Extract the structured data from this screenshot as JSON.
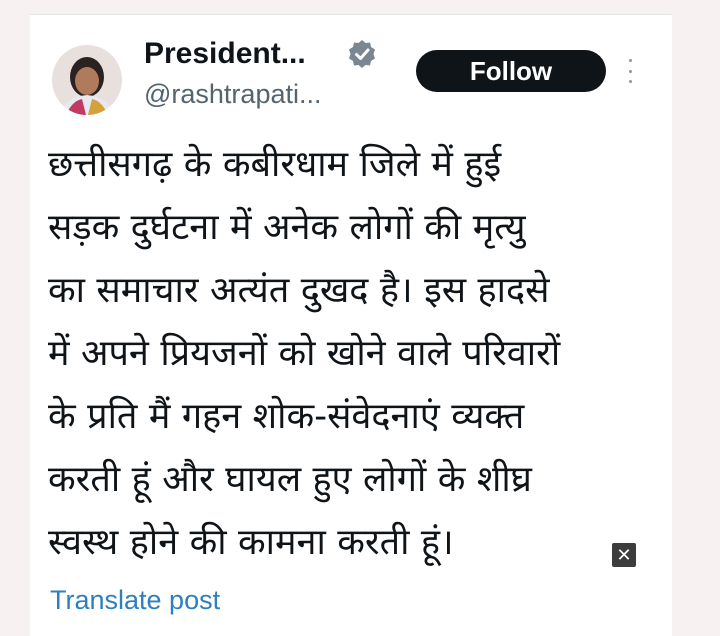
{
  "header": {
    "display_name": "President...",
    "handle": "@rashtrapati...",
    "follow_label": "Follow"
  },
  "post": {
    "lines": [
      "छत्तीसगढ़ के कबीरधाम जिले में हुई",
      "सड़क दुर्घटना में अनेक लोगों की मृत्यु",
      "का समाचार अत्यंत दुखद है। इस हादसे",
      "में अपने प्रियजनों को खोने वाले परिवारों",
      "के प्रति मैं गहन शोक-संवेदनाएं व्यक्त",
      "करती हूं और घायल हुए लोगों के शीघ्र",
      "स्वस्थ होने की कामना करती हूं।"
    ],
    "translate_label": "Translate post"
  },
  "icons": {
    "verified": "verified-badge-icon",
    "more": "more-options-icon",
    "close": "close-icon"
  },
  "colors": {
    "follow_bg": "#0f1419",
    "link": "#2d7fbf",
    "verified": "#7a8793"
  }
}
